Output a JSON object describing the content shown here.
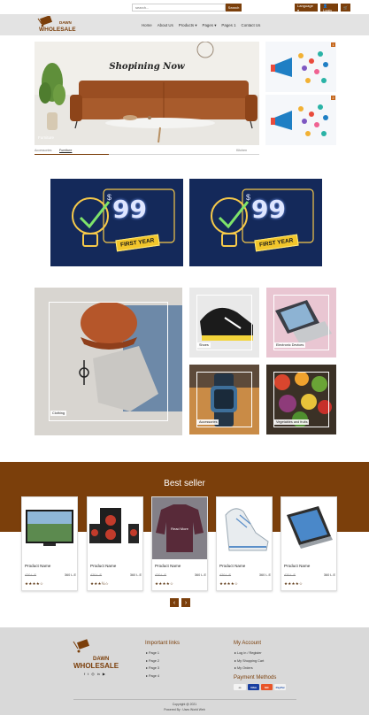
{
  "topbar": {
    "search_placeholder": "search...",
    "search_label": "Search",
    "language_label": "Language ▾",
    "login_label": "👤 Login",
    "cart_label": "🛒"
  },
  "brand": {
    "logo_top": "DAWN",
    "logo_bottom": "WHOLESALE",
    "accent_color": "#7b3f0b"
  },
  "nav": {
    "items": [
      "Home",
      "About Us",
      "Products ▾",
      "Pages ▾",
      "Pages 1",
      "Contact Us"
    ]
  },
  "hero": {
    "title": "Shopining Now",
    "caption": "Furniture",
    "thumbs": [
      "Accessories",
      "Furniture",
      "Kitchen"
    ],
    "active_thumb": 1,
    "progress": 0.33
  },
  "promos": [
    {
      "badge": "1"
    },
    {
      "badge": "2"
    }
  ],
  "offers": [
    {
      "price": "99",
      "currency": "$",
      "tag": "FIRST YEAR"
    },
    {
      "price": "99",
      "currency": "$",
      "tag": "FIRST YEAR"
    }
  ],
  "categories": {
    "clothing": "Clothing",
    "shoes": "Shoes",
    "electronic": "Electronic Devices",
    "accessories": "Accessories",
    "vegetables": "Vegetables and fruits"
  },
  "best_seller": {
    "title": "Best seller",
    "products": [
      {
        "name": "Product Name",
        "old_price": "420 L.E",
        "new_price": "360 L.E",
        "stars": "★★★★☆"
      },
      {
        "name": "Product Name",
        "old_price": "420 L.E",
        "new_price": "360 L.E",
        "stars": "★★★½☆"
      },
      {
        "name": "Product Name",
        "old_price": "420 L.E",
        "new_price": "360 L.E",
        "stars": "★★★★☆",
        "overlay": "Read More"
      },
      {
        "name": "Product Name",
        "old_price": "420 L.E",
        "new_price": "360 L.E",
        "stars": "★★★★☆"
      },
      {
        "name": "Product Name",
        "old_price": "420 L.E",
        "new_price": "360 L.E",
        "stars": "★★★★☆"
      }
    ],
    "prev": "‹",
    "next": "›"
  },
  "footer": {
    "important_title": "Important links",
    "important_links": [
      "▸ Page 1",
      "▸ Page 2",
      "▸ Page 3",
      "▸ Page 4"
    ],
    "account_title": "My Account",
    "account_links": [
      "▸ Log in  /  Register",
      "▸ My Shopping Cart",
      "▸ My Orders"
    ],
    "payment_title": "Payment Methods",
    "payments": [
      "VISA",
      "MC",
      "PayPal"
    ],
    "social": [
      "f",
      "t",
      "◎",
      "in",
      "▶"
    ],
    "copyright": "Copyright @ 2021",
    "powered": "Powered By : Uses World Web"
  }
}
